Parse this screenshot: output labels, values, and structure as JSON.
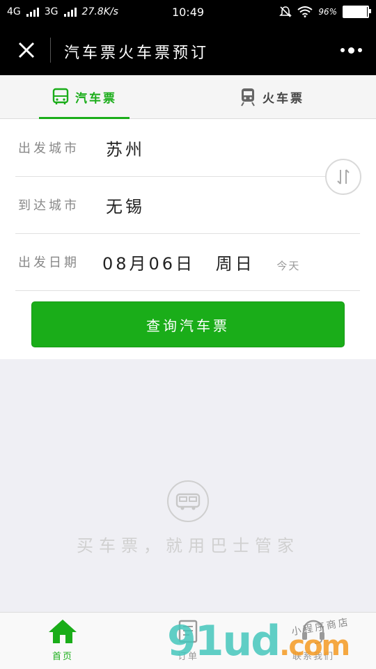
{
  "status_bar": {
    "net1": "4G",
    "net2": "3G",
    "speed": "27.8K/s",
    "time": "10:49",
    "battery": "96%"
  },
  "nav": {
    "title": "汽车票火车票预订",
    "close_icon": "close-icon",
    "more_icon": "more-icon"
  },
  "tabs": [
    {
      "label": "汽车票",
      "icon": "bus-icon",
      "active": true
    },
    {
      "label": "火车票",
      "icon": "train-icon",
      "active": false
    }
  ],
  "form": {
    "depart_label": "出发城市",
    "depart_value": "苏州",
    "arrive_label": "到达城市",
    "arrive_value": "无锡",
    "date_label": "出发日期",
    "date_value": "08月06日",
    "weekday": "周日",
    "today": "今天",
    "swap_icon": "swap-icon"
  },
  "search_button": "查询汽车票",
  "empty": {
    "slogan": "买车票，就用巴士管家",
    "icon": "bus-icon"
  },
  "tabbar": [
    {
      "label": "首页",
      "icon": "home-icon",
      "active": true
    },
    {
      "label": "订单",
      "icon": "order-icon",
      "active": false
    },
    {
      "label": "联系我们",
      "icon": "headset-icon",
      "active": false
    }
  ],
  "watermark": {
    "logo": "91ud",
    "domain": ".com",
    "small": "小程序商店"
  },
  "colors": {
    "accent": "#1aad19",
    "nav_bg": "#000000",
    "page_bg": "#efeff4"
  }
}
